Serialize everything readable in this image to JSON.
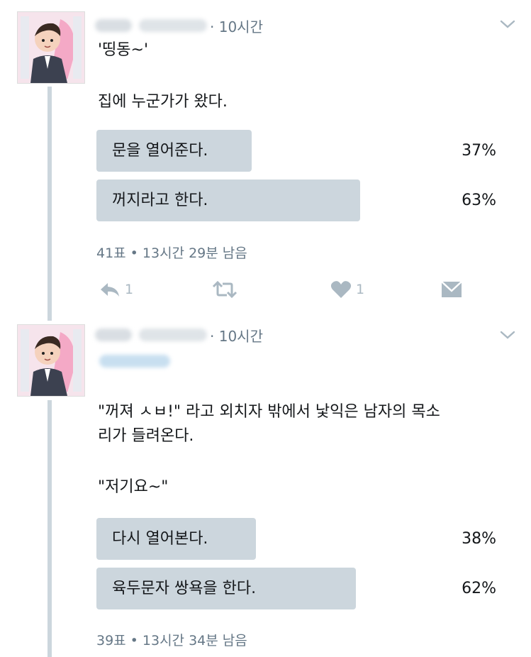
{
  "tweets": [
    {
      "time": "· 10시간",
      "lines": [
        "'띵동~'",
        "집에 누군가가 왔다."
      ],
      "poll": {
        "options": [
          {
            "label": "문을 열어준다.",
            "percent_text": "37%",
            "percent": 37
          },
          {
            "label": "꺼지라고 한다.",
            "percent_text": "63%",
            "percent": 63
          }
        ],
        "votes": "41표",
        "separator": "•",
        "remaining": "13시간 29분 남음"
      },
      "actions": {
        "reply_count": "1",
        "like_count": "1"
      }
    },
    {
      "time": "· 10시간",
      "lines": [
        "\"꺼져 ㅅㅂ!\" 라고 외치자 밖에서 낯익은 남자의 목소",
        "리가 들려온다.",
        "\"저기요~\""
      ],
      "poll": {
        "options": [
          {
            "label": "다시 열어본다.",
            "percent_text": "38%",
            "percent": 38
          },
          {
            "label": "육두문자 쌍욕을 한다.",
            "percent_text": "62%",
            "percent": 62
          }
        ],
        "votes": "39표",
        "separator": "•",
        "remaining": "13시간 34분 남음"
      }
    }
  ],
  "colors": {
    "bar": "#ccd6dd",
    "muted": "#657786",
    "icon": "#aab8c2",
    "thread_line": "#ccd6dd"
  },
  "icons": {
    "chevron": "chevron-down-icon",
    "reply": "reply-icon",
    "retweet": "retweet-icon",
    "like": "heart-icon",
    "dm": "envelope-icon"
  }
}
